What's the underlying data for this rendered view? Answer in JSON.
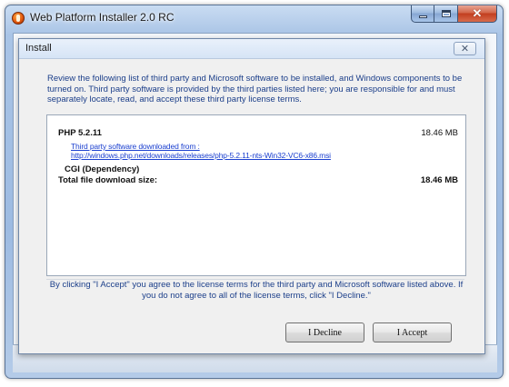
{
  "window": {
    "title": "Web Platform Installer 2.0 RC",
    "controls": {
      "minimize": "minimize",
      "maximize": "maximize",
      "close": "close"
    }
  },
  "dialog": {
    "title": "Install",
    "close_glyph": "✕",
    "intro": "Review the following list of third party and Microsoft software to be installed, and Windows components to be turned on.  Third party software is provided by the third parties listed here; you are responsible for and must separately locate, read, and accept these third party license terms.",
    "packages": [
      {
        "name": "PHP 5.2.11",
        "size": "18.46 MB",
        "link_label": "Third party software downloaded from :",
        "link_url": "http://windows.php.net/downloads/releases/php-5.2.11-nts-Win32-VC6-x86.msi"
      }
    ],
    "dependency": "CGI (Dependency)",
    "total_label": "Total file download size:",
    "total_value": "18.46 MB",
    "license_note": "By clicking \"I Accept\" you agree to the license terms for the third party and Microsoft software listed above. If you do not agree to all of the license terms, click \"I Decline.\"",
    "buttons": {
      "decline": "I Decline",
      "accept": "I Accept"
    }
  }
}
